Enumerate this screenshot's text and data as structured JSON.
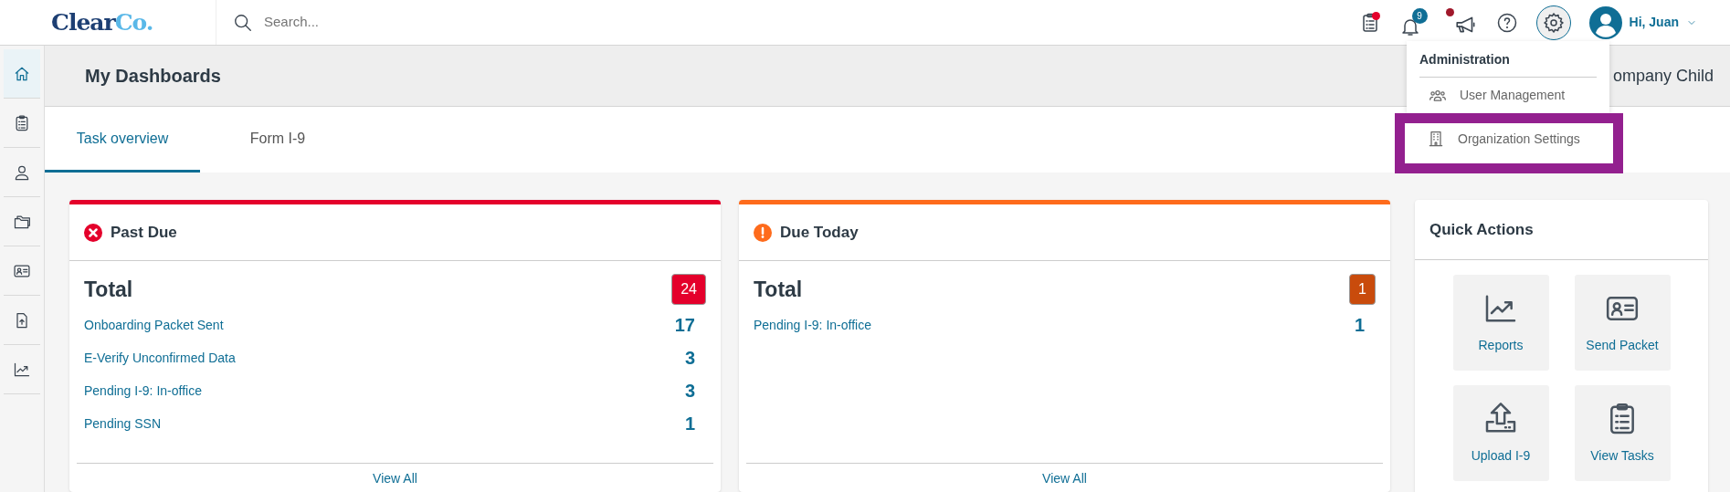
{
  "brand": {
    "logo_first": "Clear",
    "logo_second": "Co."
  },
  "search": {
    "placeholder": "Search..."
  },
  "toolbar": {
    "tasks_alert": true,
    "notifications": "9",
    "announcements_alert": true,
    "settings_open": true,
    "greeting": "Hi, Juan"
  },
  "sidebar": {
    "items": [
      {
        "kind": "home",
        "selected": true
      },
      {
        "kind": "tasks",
        "selected": false
      },
      {
        "kind": "person",
        "selected": false
      },
      {
        "kind": "folders",
        "selected": false
      },
      {
        "kind": "id-card",
        "selected": false
      },
      {
        "kind": "upload-doc",
        "selected": false
      },
      {
        "kind": "chart",
        "selected": false
      }
    ]
  },
  "header": {
    "title": "My Dashboards",
    "company": "ompany Child"
  },
  "tabs": [
    {
      "label": "Task overview",
      "selected": true
    },
    {
      "label": "Form I-9",
      "selected": false
    }
  ],
  "cards": [
    {
      "kind": "past_due",
      "title": "Past Due",
      "color": "#e4002b",
      "total_label": "Total",
      "total": "24",
      "rows": [
        {
          "label": "Onboarding Packet Sent",
          "count": "17"
        },
        {
          "label": "E-Verify Unconfirmed Data",
          "count": "3"
        },
        {
          "label": "Pending I-9: In-office",
          "count": "3"
        },
        {
          "label": "Pending SSN",
          "count": "1"
        }
      ],
      "footer": "View All"
    },
    {
      "kind": "due_today",
      "title": "Due Today",
      "color": "#fe6b1c",
      "total_label": "Total",
      "total": "1",
      "rows": [
        {
          "label": "Pending I-9: In-office",
          "count": "1"
        }
      ],
      "footer": "View All"
    }
  ],
  "quick_actions": {
    "title": "Quick Actions",
    "items": [
      {
        "kind": "reports",
        "label": "Reports"
      },
      {
        "kind": "send",
        "label": "Send Packet"
      },
      {
        "kind": "upload",
        "label": "Upload I-9"
      },
      {
        "kind": "tasks",
        "label": "View Tasks"
      }
    ]
  },
  "menu": {
    "heading": "Administration",
    "items": [
      {
        "kind": "users",
        "label": "User Management",
        "highlighted": false
      },
      {
        "kind": "building",
        "label": "Organization Settings",
        "highlighted": true
      }
    ]
  }
}
